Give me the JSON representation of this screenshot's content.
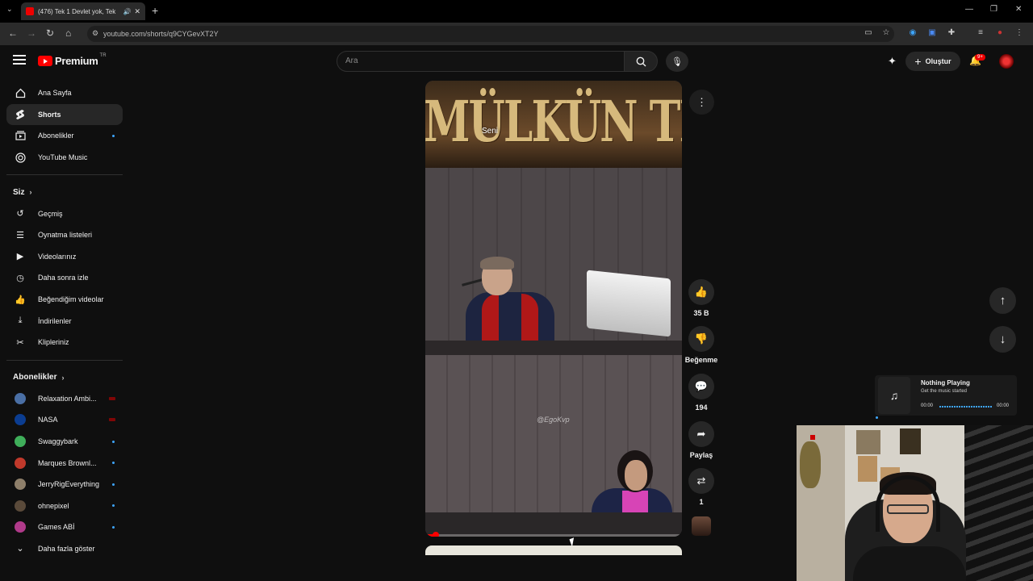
{
  "browser": {
    "tab_title": "(476) Tek 1 Devlet yok, Tek",
    "url": "youtube.com/shorts/q9CYGevXT2Y"
  },
  "header": {
    "logo_text": "Premium",
    "logo_region": "TR",
    "search_placeholder": "Ara",
    "create_label": "Oluştur",
    "notification_count": "9+"
  },
  "sidebar": {
    "main": [
      {
        "label": "Ana Sayfa",
        "icon": "home-icon"
      },
      {
        "label": "Shorts",
        "icon": "shorts-icon",
        "active": true
      },
      {
        "label": "Abonelikler",
        "icon": "subscriptions-icon"
      },
      {
        "label": "YouTube Music",
        "icon": "music-icon"
      }
    ],
    "you_heading": "Siz",
    "you": [
      {
        "label": "Geçmiş",
        "icon": "history-icon"
      },
      {
        "label": "Oynatma listeleri",
        "icon": "playlists-icon"
      },
      {
        "label": "Videolarınız",
        "icon": "your-videos-icon"
      },
      {
        "label": "Daha sonra izle",
        "icon": "watch-later-icon"
      },
      {
        "label": "Beğendiğim videolar",
        "icon": "liked-icon"
      },
      {
        "label": "İndirilenler",
        "icon": "download-icon"
      },
      {
        "label": "Klipleriniz",
        "icon": "clips-icon"
      }
    ],
    "subs_heading": "Abonelikler",
    "subscriptions": [
      {
        "label": "Relaxation Ambi...",
        "color": "#4a6fa5",
        "live": true
      },
      {
        "label": "NASA",
        "color": "#0b3d91",
        "live": true
      },
      {
        "label": "Swaggybark",
        "color": "#3fae5a"
      },
      {
        "label": "Marques Brownl...",
        "color": "#c0392b"
      },
      {
        "label": "JerryRigEverything",
        "color": "#8e7f6a"
      },
      {
        "label": "ohnepixel",
        "color": "#5a4a3a"
      },
      {
        "label": "Games ABİ",
        "color": "#b03a8a"
      }
    ],
    "show_more": "Daha fazla göster"
  },
  "video": {
    "sign_text": "MÜLKÜN TEMEL",
    "caption": "Seni",
    "watermark": "@EgoKvp",
    "progress": 0.04
  },
  "actions": {
    "likes": "35 B",
    "dislike_label": "Beğenme",
    "comments": "194",
    "share_label": "Paylaş",
    "remix_count": "1"
  },
  "music_widget": {
    "title": "Nothing Playing",
    "subtitle": "Get the music started",
    "time_start": "00:00",
    "time_end": "00:00"
  }
}
